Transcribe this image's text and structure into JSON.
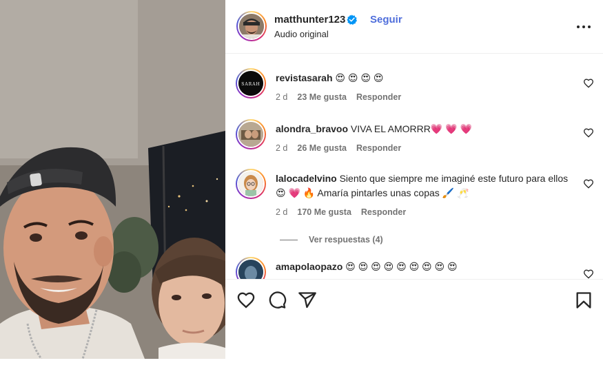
{
  "post": {
    "username": "matthunter123",
    "follow_label": "Seguir",
    "subtitle": "Audio original"
  },
  "comments": [
    {
      "username": "revistasarah",
      "text": "😍 😍 😍 😍",
      "age": "2 d",
      "likes": "23 Me gusta",
      "reply_label": "Responder",
      "avatar_text": "SARAH"
    },
    {
      "username": "alondra_bravoo",
      "text": "VIVA EL AMORRR💗 💗 💗",
      "age": "2 d",
      "likes": "26 Me gusta",
      "reply_label": "Responder"
    },
    {
      "username": "lalocadelvino",
      "text": "Siento que siempre me imaginé este futuro para ellos 😍 💗 🔥  Amaría pintarles unas copas 🖌️ 🥂",
      "age": "2 d",
      "likes": "170 Me gusta",
      "reply_label": "Responder",
      "view_replies": "Ver respuestas (4)"
    },
    {
      "username": "amapolaopazo",
      "text": "😍 😍 😍 😍 😍 😍 😍 😍 😍"
    }
  ],
  "icons": [
    "verified-badge-icon",
    "more-options-icon",
    "heart-icon",
    "comment-icon",
    "share-icon",
    "bookmark-icon"
  ],
  "colors": {
    "link": "#4f6edb",
    "muted": "#737373",
    "text": "#262626",
    "verified": "#0095f6"
  }
}
